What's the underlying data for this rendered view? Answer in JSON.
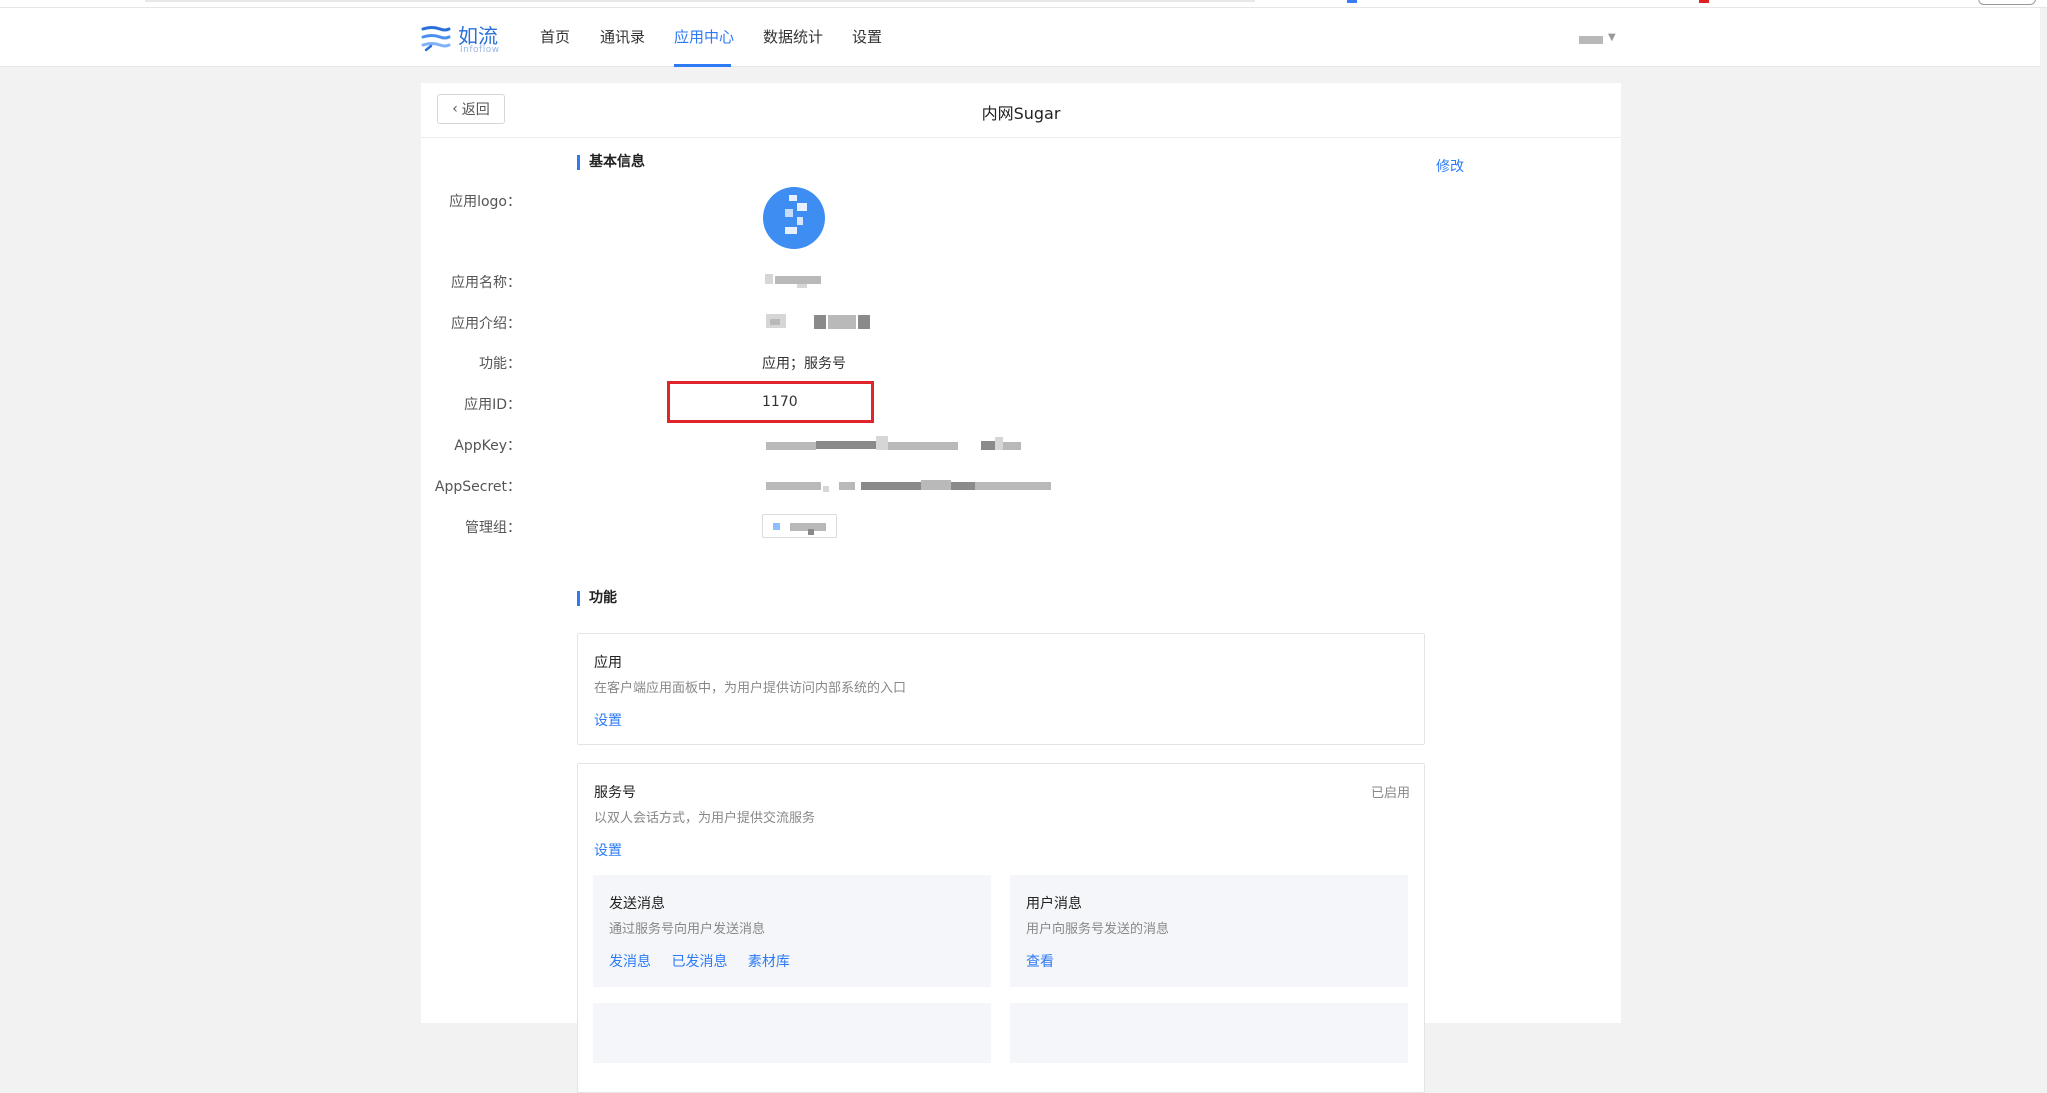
{
  "nav": {
    "logo_name": "如流",
    "logo_sub": "Infoflow",
    "items": [
      {
        "label": "首页"
      },
      {
        "label": "通讯录"
      },
      {
        "label": "应用中心"
      },
      {
        "label": "数据统计"
      },
      {
        "label": "设置"
      }
    ],
    "active_item": "应用中心",
    "accent_color": "#2d7bf4"
  },
  "page": {
    "back_label": "返回",
    "title": "内网Sugar"
  },
  "basic_info": {
    "section_title": "基本信息",
    "edit_label": "修改",
    "fields": {
      "logo_label": "应用logo：",
      "name_label": "应用名称：",
      "intro_label": "应用介绍：",
      "function_label": "功能：",
      "function_value": "应用；服务号",
      "id_label": "应用ID：",
      "id_value": "1170",
      "appkey_label": "AppKey：",
      "appsecret_label": "AppSecret：",
      "group_label": "管理组："
    }
  },
  "functions": {
    "section_title": "功能",
    "app": {
      "title": "应用",
      "desc": "在客户端应用面板中，为用户提供访问内部系统的入口",
      "link": "设置"
    },
    "service": {
      "title": "服务号",
      "desc": "以双人会话方式，为用户提供交流服务",
      "link": "设置",
      "status": "已启用",
      "send": {
        "title": "发送消息",
        "desc": "通过服务号向用户发送消息",
        "links": [
          "发消息",
          "已发消息",
          "素材库"
        ]
      },
      "user_msg": {
        "title": "用户消息",
        "desc": "用户向服务号发送的消息",
        "link": "查看"
      }
    }
  },
  "highlight_color": "#e0242b"
}
